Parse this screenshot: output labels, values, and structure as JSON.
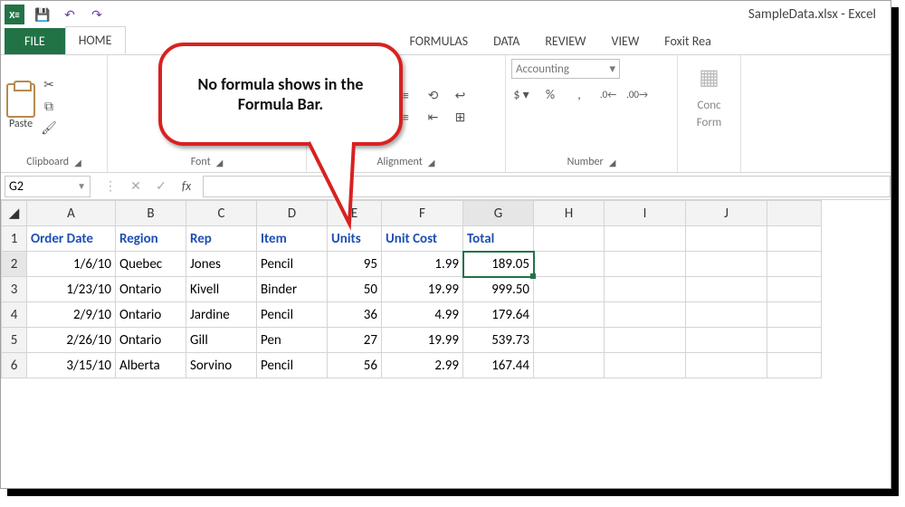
{
  "title": "SampleData.xlsx - Excel",
  "qat": {
    "save": "💾",
    "undo": "↶",
    "redo": "↷"
  },
  "tabs": {
    "file": "FILE",
    "home": "HOME",
    "formulas": "FORMULAS",
    "data": "DATA",
    "review": "REVIEW",
    "view": "VIEW",
    "foxit": "Foxit Rea"
  },
  "ribbon": {
    "clipboard": {
      "paste": "Paste",
      "label": "Clipboard"
    },
    "font": {
      "label": "Font"
    },
    "alignment": {
      "label": "Alignment"
    },
    "number": {
      "format": "Accounting",
      "label": "Number"
    },
    "cond": {
      "line1": "Conc",
      "line2": "Form"
    }
  },
  "fx": {
    "namebox": "G2",
    "fx_label": "fx"
  },
  "columns": [
    "A",
    "B",
    "C",
    "D",
    "E",
    "F",
    "G",
    "H",
    "I",
    "J",
    ""
  ],
  "headers": {
    "A": "Order Date",
    "B": "Region",
    "C": "Rep",
    "D": "Item",
    "E": "Units",
    "F": "Unit Cost",
    "G": "Total"
  },
  "rows": [
    {
      "n": "1"
    },
    {
      "n": "2",
      "A": "1/6/10",
      "B": "Quebec",
      "C": "Jones",
      "D": "Pencil",
      "E": "95",
      "F": "1.99",
      "G": "189.05"
    },
    {
      "n": "3",
      "A": "1/23/10",
      "B": "Ontario",
      "C": "Kivell",
      "D": "Binder",
      "E": "50",
      "F": "19.99",
      "G": "999.50"
    },
    {
      "n": "4",
      "A": "2/9/10",
      "B": "Ontario",
      "C": "Jardine",
      "D": "Pencil",
      "E": "36",
      "F": "4.99",
      "G": "179.64"
    },
    {
      "n": "5",
      "A": "2/26/10",
      "B": "Ontario",
      "C": "Gill",
      "D": "Pen",
      "E": "27",
      "F": "19.99",
      "G": "539.73"
    },
    {
      "n": "6",
      "A": "3/15/10",
      "B": "Alberta",
      "C": "Sorvino",
      "D": "Pencil",
      "E": "56",
      "F": "2.99",
      "G": "167.44"
    }
  ],
  "callout": "No formula shows in the Formula Bar."
}
